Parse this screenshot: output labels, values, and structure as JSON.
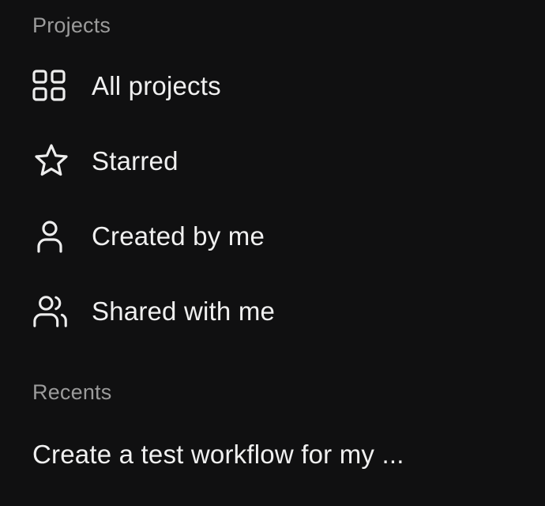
{
  "sidebar": {
    "projects_section": {
      "label": "Projects",
      "items": [
        {
          "label": "All projects",
          "icon": "grid-icon"
        },
        {
          "label": "Starred",
          "icon": "star-icon"
        },
        {
          "label": "Created by me",
          "icon": "user-icon"
        },
        {
          "label": "Shared with me",
          "icon": "users-icon"
        }
      ]
    },
    "recents_section": {
      "label": "Recents",
      "items": [
        {
          "label": "Create a test workflow for my ..."
        }
      ]
    }
  }
}
